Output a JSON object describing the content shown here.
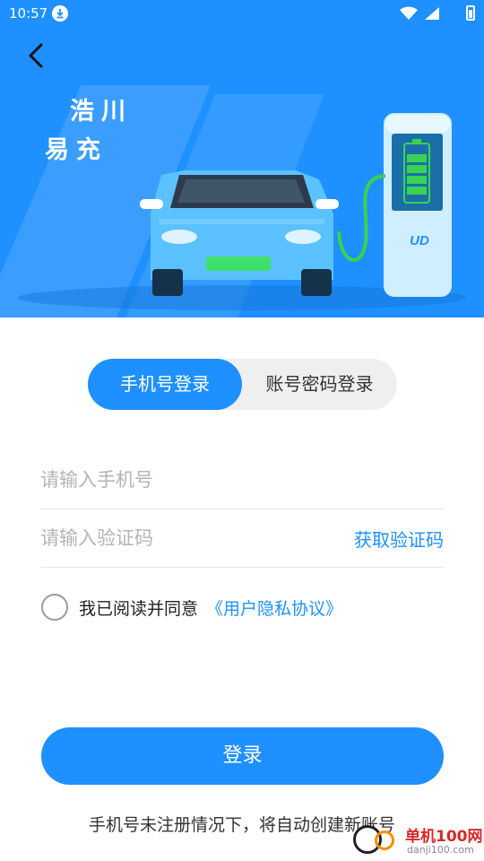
{
  "status_bar": {
    "time": "10:57"
  },
  "hero": {
    "brand_line1": "浩川",
    "brand_line2": "易充",
    "pump_logo": "UD"
  },
  "tabs": [
    {
      "label": "手机号登录",
      "active": true
    },
    {
      "label": "账号密码登录",
      "active": false
    }
  ],
  "form": {
    "phone_placeholder": "请输入手机号",
    "phone_value": "",
    "code_placeholder": "请输入验证码",
    "code_value": "",
    "get_code_label": "获取验证码"
  },
  "agreement": {
    "checked": false,
    "text": "我已阅读并同意",
    "link": "《用户隐私协议》"
  },
  "login_label": "登录",
  "footer_note": "手机号未注册情况下，将自动创建新账号",
  "watermark": {
    "text1": "单机100网",
    "text2": "danji100.com"
  },
  "colors": {
    "primary": "#1e90ff",
    "tab_bg": "#efefef",
    "placeholder": "#b4b4b4"
  }
}
